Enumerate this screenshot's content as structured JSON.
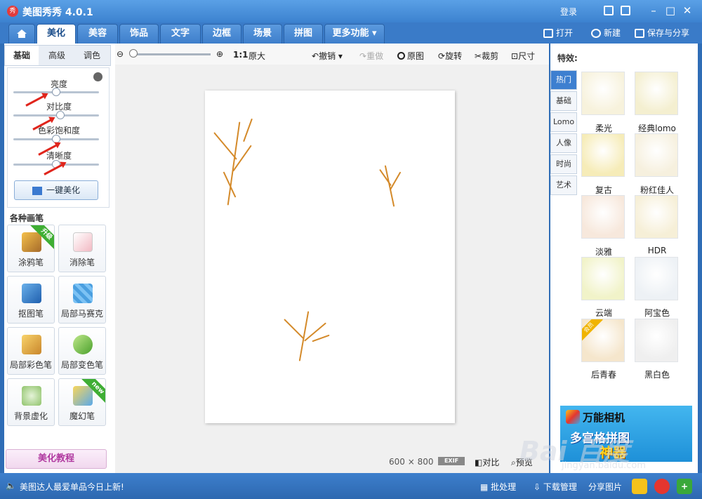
{
  "app": {
    "title": "美图秀秀 4.0.1",
    "logo_text": "秀"
  },
  "titlebar": {
    "login": "登录",
    "icons": [
      "message-icon",
      "skin-icon"
    ],
    "window_buttons": [
      "minimize-icon",
      "maximize-icon",
      "close-icon"
    ]
  },
  "menubar": {
    "tabs": [
      {
        "label": "美化",
        "active": true
      },
      {
        "label": "美容"
      },
      {
        "label": "饰品"
      },
      {
        "label": "文字"
      },
      {
        "label": "边框"
      },
      {
        "label": "场景"
      },
      {
        "label": "拼图"
      },
      {
        "label": "更多功能"
      }
    ],
    "actions": {
      "open": "打开",
      "new": "新建",
      "save": "保存与分享"
    }
  },
  "left": {
    "subtabs": [
      "基础",
      "高级",
      "调色"
    ],
    "sliders": [
      {
        "label": "亮度",
        "value": 0.5
      },
      {
        "label": "对比度",
        "value": 0.55
      },
      {
        "label": "色彩饱和度",
        "value": 0.5
      },
      {
        "label": "清晰度",
        "value": 0.5
      }
    ],
    "one_key": "一键美化",
    "brushes_title": "各种画笔",
    "tools": [
      {
        "label": "涂鸦笔",
        "badge": "升级"
      },
      {
        "label": "消除笔"
      },
      {
        "label": "抠图笔"
      },
      {
        "label": "局部马赛克"
      },
      {
        "label": "局部彩色笔"
      },
      {
        "label": "局部变色笔"
      },
      {
        "label": "背景虚化"
      },
      {
        "label": "魔幻笔",
        "badge": "new"
      }
    ],
    "tutorial": "美化教程"
  },
  "toolbar": {
    "zoom_ratio": "1:1",
    "original_size": "原大",
    "undo": "撤销",
    "redo": "重做",
    "original": "原图",
    "rotate": "旋转",
    "crop": "裁剪",
    "size": "尺寸"
  },
  "image": {
    "width": "600",
    "times": "×",
    "height": "800",
    "exif": "EXIF",
    "compare": "对比",
    "preview": "预览"
  },
  "right": {
    "title": "特效:",
    "vtabs": [
      "热门",
      "基础",
      "Lomo",
      "人像",
      "时尚",
      "艺术"
    ],
    "effects": [
      {
        "label": "柔光",
        "color": "#f7f2dc"
      },
      {
        "label": "经典lomo",
        "color": "#f4efd0"
      },
      {
        "label": "复古",
        "color": "#f6ecb8"
      },
      {
        "label": "粉红佳人",
        "color": "#f6f0de"
      },
      {
        "label": "淡雅",
        "color": "#f7e8dc"
      },
      {
        "label": "HDR",
        "color": "#f6efd7"
      },
      {
        "label": "云端",
        "color": "#f1f3c9"
      },
      {
        "label": "阿宝色",
        "color": "#edf1f5"
      },
      {
        "label": "后青春",
        "color": "#f5e6cc",
        "badge": "会员"
      },
      {
        "label": "黑白色",
        "color": "#efefef"
      }
    ],
    "ad": {
      "line1": "万能相机",
      "line2": "多宫格拼图",
      "line3": "神器"
    }
  },
  "status": {
    "message": "美图达人最爱单品今日上新!",
    "batch": "批处理",
    "download": "下载管理",
    "share": "分享图片"
  },
  "watermark": {
    "logo": "Bai 百度",
    "url": "jingyan.baidu.com"
  }
}
